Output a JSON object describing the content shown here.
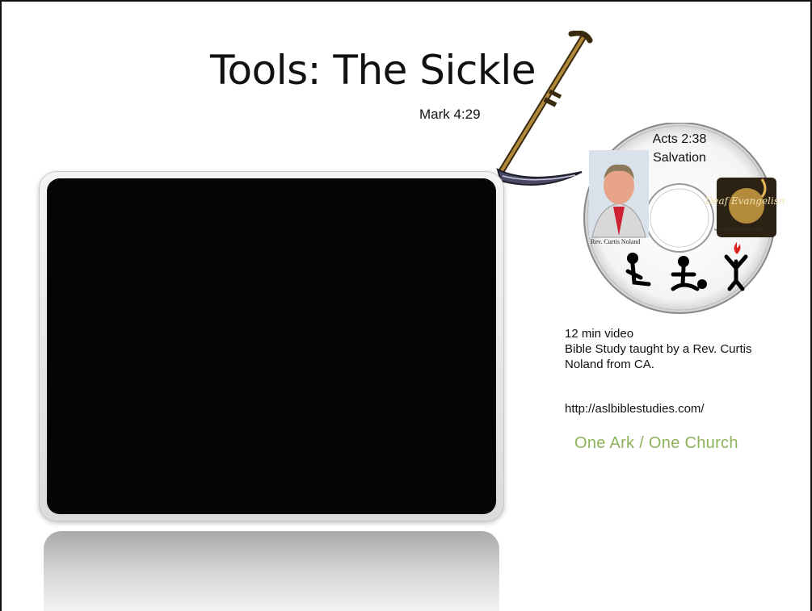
{
  "slide": {
    "title": "Tools: The Sickle",
    "subtitle": "Mark 4:29",
    "disc": {
      "line1": "Acts 2:38",
      "line2": "Salvation",
      "caption": "Rev. Curtis Noland",
      "logo_url": "www.deafevangelism.com",
      "logo_text": "Deaf Evangelism"
    },
    "info": {
      "line1": "12 min video",
      "line2": "Bible Study taught by a Rev. Curtis",
      "line3": "Noland from CA."
    },
    "url": "http://aslbiblestudies.com/",
    "tagline": "One Ark / One Church",
    "colors": {
      "tagline": "#8db35a",
      "video_screen": "#050505"
    }
  }
}
